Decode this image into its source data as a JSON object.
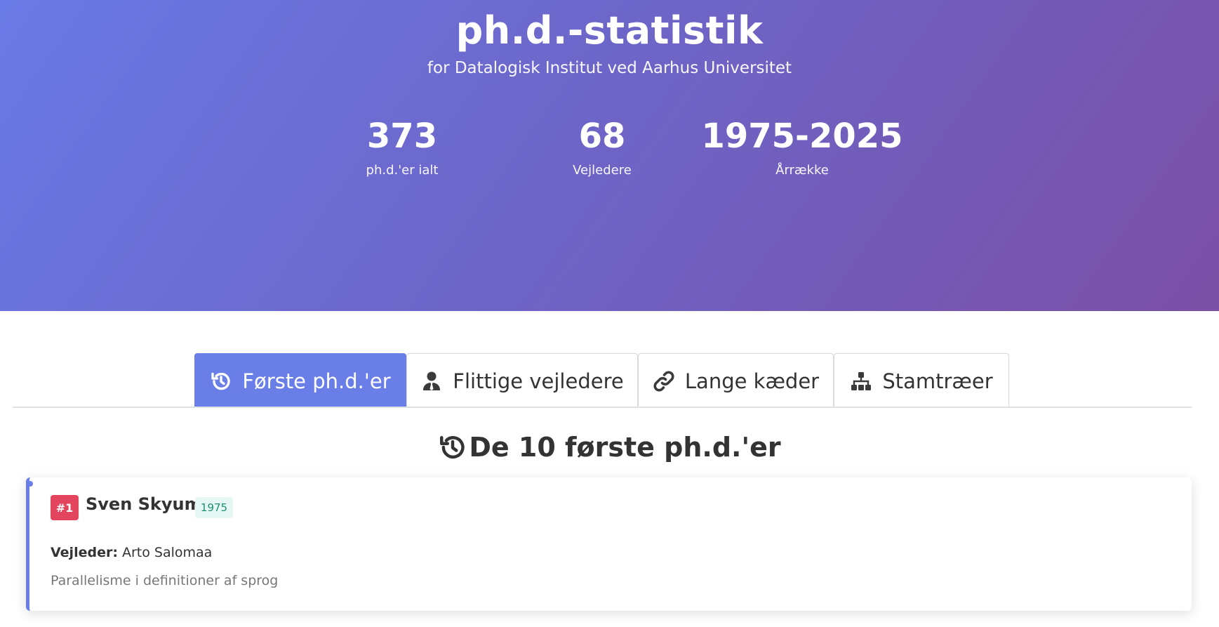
{
  "header": {
    "title": "ph.d.-statistik",
    "subtitle": "for Datalogisk Institut ved Aarhus Universitet"
  },
  "stats": [
    {
      "value": "373",
      "label": "ph.d.'er ialt"
    },
    {
      "value": "68",
      "label": "Vejledere"
    },
    {
      "value": "1975-2025",
      "label": "Årrække"
    }
  ],
  "tabs": [
    {
      "label": "Første ph.d.'er",
      "icon": "history-icon",
      "active": true
    },
    {
      "label": "Flittige vejledere",
      "icon": "user-tie-icon",
      "active": false
    },
    {
      "label": "Lange kæder",
      "icon": "link-icon",
      "active": false
    },
    {
      "label": "Stamtræer",
      "icon": "sitemap-icon",
      "active": false
    }
  ],
  "section": {
    "title": "De 10 første ph.d.'er",
    "icon": "history-icon"
  },
  "entries": [
    {
      "rank": "#1",
      "name": "Sven Skyum",
      "year": "1975",
      "advisor_label": "Vejleder:",
      "advisor": "Arto Salomaa",
      "thesis": "Parallelisme i definitioner af sprog"
    }
  ],
  "colors": {
    "accent": "#6a7ee8",
    "rank_badge": "#e3455e",
    "year_badge_bg": "#e6f8f3",
    "year_badge_text": "#1f8f72"
  }
}
